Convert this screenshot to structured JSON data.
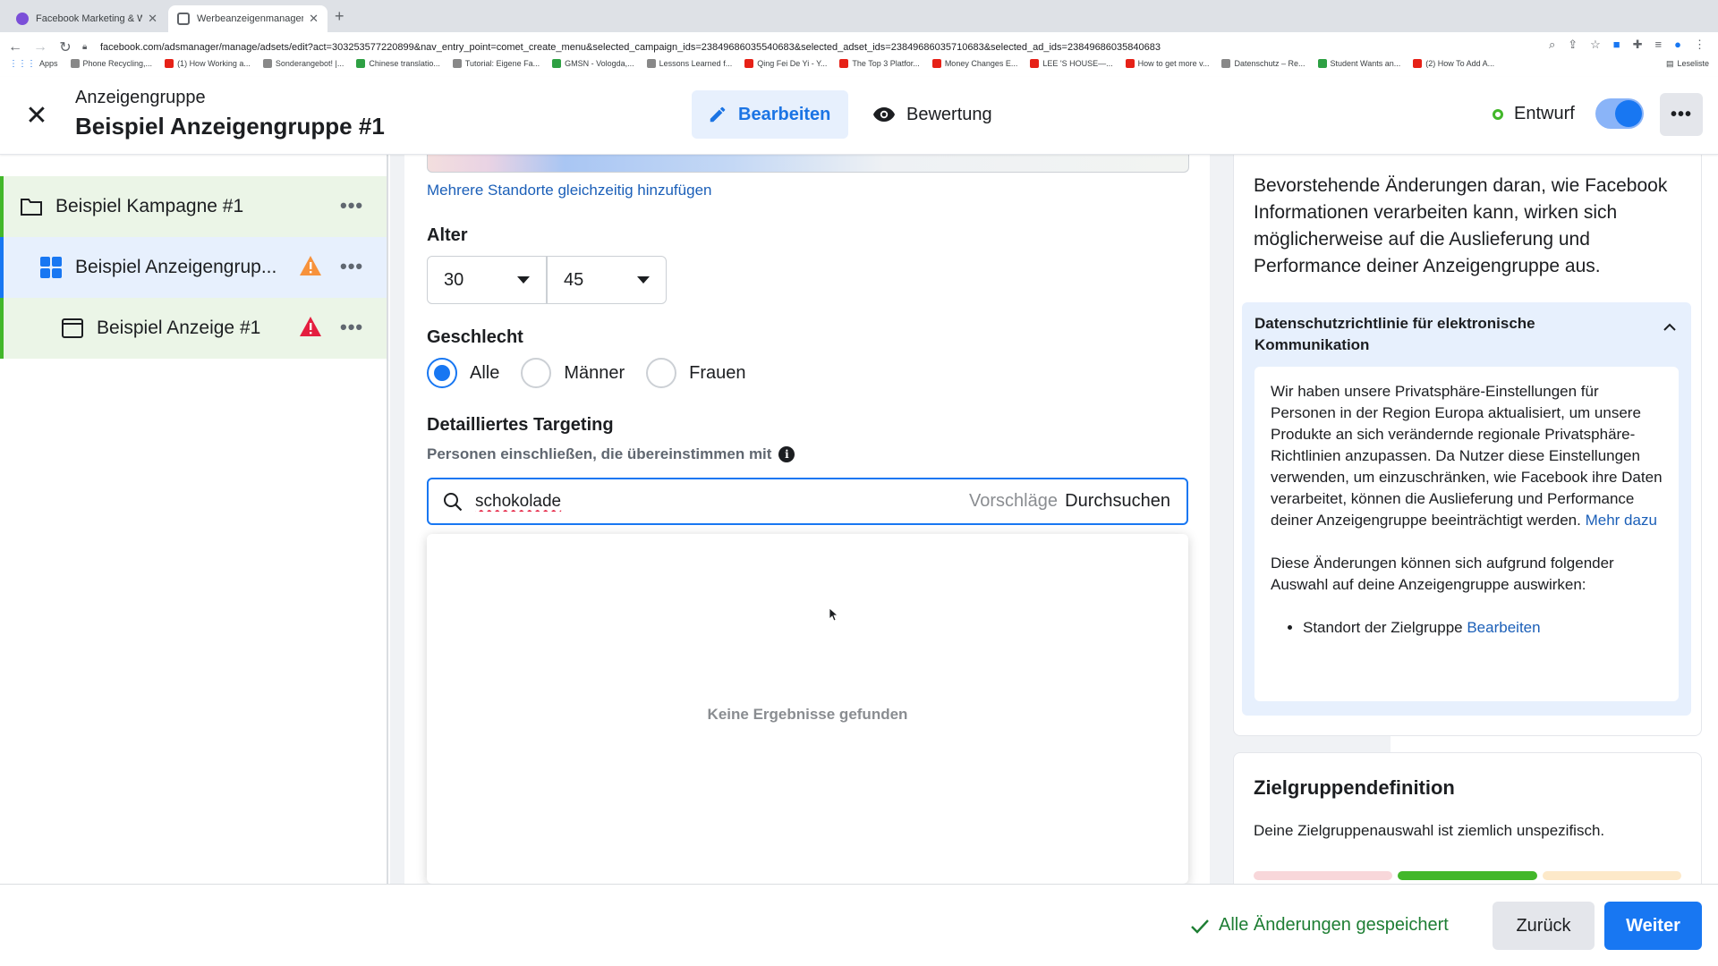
{
  "browser": {
    "tabs": [
      {
        "title": "Facebook Marketing & Werbea...",
        "close": "✕"
      },
      {
        "title": "Werbeanzeigenmanager - Wer...",
        "close": "✕"
      }
    ],
    "new_tab": "+",
    "url": "facebook.com/adsmanager/manage/adsets/edit?act=303253577220899&nav_entry_point=comet_create_menu&selected_campaign_ids=23849686035540683&selected_adset_ids=23849686035710683&selected_ad_ids=23849686035840683",
    "bookmarks": [
      "Apps",
      "Phone Recycling,...",
      "(1) How Working a...",
      "Sonderangebot! |...",
      "Chinese translatio...",
      "Tutorial: Eigene Fa...",
      "GMSN - Vologda,...",
      "Lessons Learned f...",
      "Qing Fei De Yi - Y...",
      "The Top 3 Platfor...",
      "Money Changes E...",
      "LEE 'S HOUSE—...",
      "How to get more v...",
      "Datenschutz – Re...",
      "Student Wants an...",
      "(2) How To Add A..."
    ],
    "reading_list": "Leseliste"
  },
  "header": {
    "subtitle": "Anzeigengruppe",
    "title": "Beispiel Anzeigengruppe #1",
    "edit_label": "Bearbeiten",
    "review_label": "Bewertung",
    "status_label": "Entwurf",
    "toggle_on": true
  },
  "tree": {
    "campaign": "Beispiel Kampagne #1",
    "adset": "Beispiel Anzeigengrup...",
    "ad": "Beispiel Anzeige #1",
    "more": "•••"
  },
  "form": {
    "add_locations_link": "Mehrere Standorte gleichzeitig hinzufügen",
    "age_label": "Alter",
    "age_min": "30",
    "age_max": "45",
    "gender_label": "Geschlecht",
    "gender_options": [
      "Alle",
      "Männer",
      "Frauen"
    ],
    "gender_selected": "Alle",
    "targeting_label": "Detailliertes Targeting",
    "targeting_sub": "Personen einschließen, die übereinstimmen mit",
    "search_value": "schokolade",
    "suggestions_label": "Vorschläge",
    "browse_label": "Durchsuchen",
    "no_results": "Keine Ergebnisse gefunden"
  },
  "right": {
    "intro": "Bevorstehende Änderungen daran, wie Facebook Informationen verarbeiten kann, wirken sich möglicherweise auf die Auslieferung und Performance deiner Anzeigengruppe aus.",
    "accordion_title": "Datenschutzrichtlinie für elektronische Kommunikation",
    "para1": "Wir haben unsere Privatsphäre-Einstellungen für Personen in der Region Europa aktualisiert, um unsere Produkte an sich verändernde regionale Privatsphäre-Richtlinien anzupassen. Da Nutzer diese Einstellungen verwenden, um einzuschränken, wie Facebook ihre Daten verarbeitet, können die Auslieferung und Performance deiner Anzeigengruppe beeinträchtigt werden.",
    "more_link": "Mehr dazu",
    "para2": "Diese Änderungen können sich aufgrund folgender Auswahl auf deine Anzeigengruppe auswirken:",
    "bullet": "Standort der Zielgruppe",
    "bullet_link": "Bearbeiten",
    "audience_title": "Zielgruppendefinition",
    "audience_text": "Deine Zielgruppenauswahl ist ziemlich unspezifisch.",
    "meter_colors": [
      "#f8d7da",
      "#42b72a",
      "#fde9c9"
    ]
  },
  "footer": {
    "saved": "Alle Änderungen gespeichert",
    "back": "Zurück",
    "next": "Weiter"
  }
}
